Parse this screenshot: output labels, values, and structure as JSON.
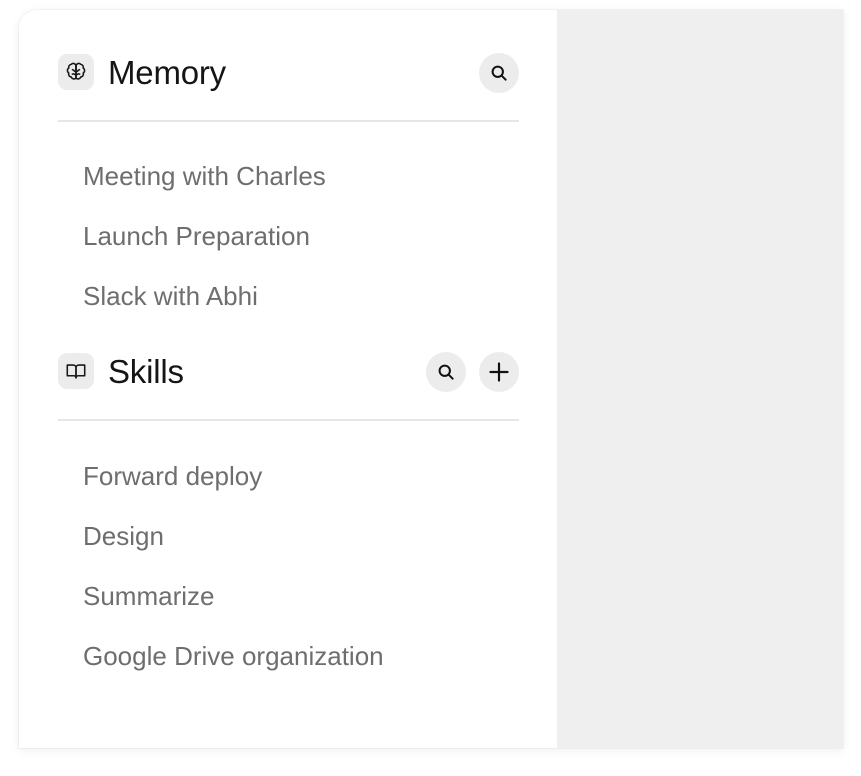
{
  "memory": {
    "icon": "brain-icon",
    "title": "Memory",
    "search_icon": "search-icon",
    "items": [
      {
        "label": "Meeting with Charles"
      },
      {
        "label": "Launch Preparation"
      },
      {
        "label": "Slack with Abhi"
      }
    ]
  },
  "skills": {
    "icon": "book-open-icon",
    "title": "Skills",
    "search_icon": "search-icon",
    "add_icon": "plus-icon",
    "items": [
      {
        "label": "Forward deploy"
      },
      {
        "label": "Design"
      },
      {
        "label": "Summarize"
      },
      {
        "label": "Google Drive organization"
      }
    ]
  },
  "colors": {
    "sidebar_bg": "#ffffff",
    "content_bg": "#efefef",
    "icon_chip_bg": "#ececec",
    "title_text": "#151515",
    "item_text": "#6e6e6e",
    "divider": "#e6e6e6"
  }
}
